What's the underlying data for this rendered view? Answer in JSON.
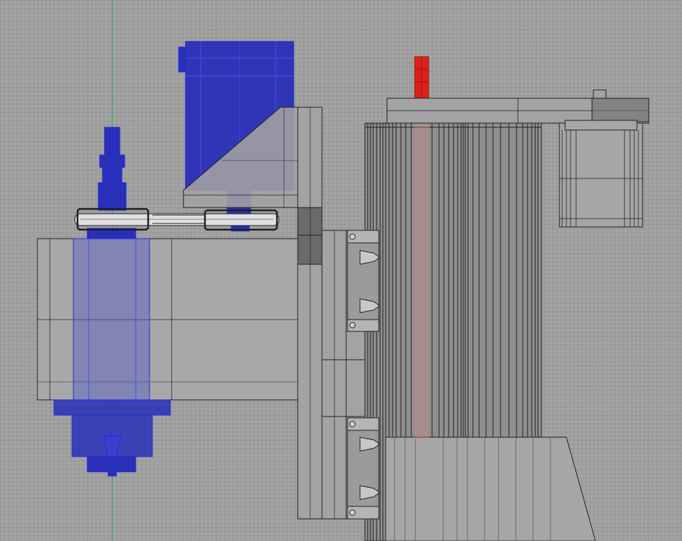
{
  "viewport": {
    "background": "#a3a3a3",
    "grid_color": "#8c8c8c",
    "y_axis_color": "#3fa34d"
  },
  "colors": {
    "selected_blue": "#1a2ee0",
    "selected_blue_fill": "#2a2fb8",
    "selected_red": "#e0201a",
    "part_gray": "#9b9b9b",
    "part_dark": "#6e6e6e",
    "edge": "#1e1e1e",
    "belt": "#d9d9d9"
  },
  "parts": [
    {
      "name": "spindle-motor",
      "state": "selected",
      "color": "blue"
    },
    {
      "name": "drive-motor",
      "state": "selected",
      "color": "blue"
    },
    {
      "name": "z-axis-leadscrew",
      "state": "highlighted",
      "color": "red"
    },
    {
      "name": "spindle-housing",
      "state": "normal",
      "color": "gray"
    },
    {
      "name": "mounting-plate",
      "state": "normal",
      "color": "gray"
    },
    {
      "name": "linear-rail-carriage",
      "state": "normal",
      "color": "gray"
    },
    {
      "name": "extrusion-column",
      "state": "normal",
      "color": "gray"
    },
    {
      "name": "stepper-motor",
      "state": "normal",
      "color": "gray"
    },
    {
      "name": "timing-belt",
      "state": "normal",
      "color": "light-gray"
    }
  ]
}
